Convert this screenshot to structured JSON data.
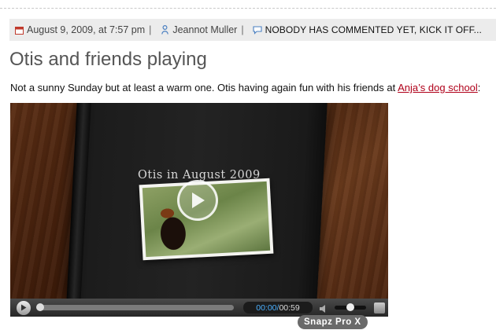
{
  "meta": {
    "date": "August 9, 2009, at 7:57 pm",
    "author": "Jeannot Muller",
    "comments": "NOBODY HAS COMMENTED YET, KICK IT OFF..."
  },
  "post": {
    "title": "Otis and friends playing",
    "intro": "Not a sunny Sunday but at least a warm one. Otis having again fun with his friends at ",
    "link_text": "Anja’s dog school",
    "outro": ":"
  },
  "video": {
    "book_title": "Otis in August 2009",
    "current_time": "00:00",
    "time_separator": "/ ",
    "duration": "00:59",
    "progress": 0,
    "volume": 0.5
  },
  "overlay": {
    "badge": "Snapz Pro X"
  },
  "icons": {
    "calendar": "calendar-icon",
    "user": "user-icon",
    "comment": "comment-bubble-icon"
  },
  "colors": {
    "link": "#b0001a",
    "title": "#555555",
    "meta_bg": "#ececec",
    "time_current": "#4bb0ff"
  }
}
